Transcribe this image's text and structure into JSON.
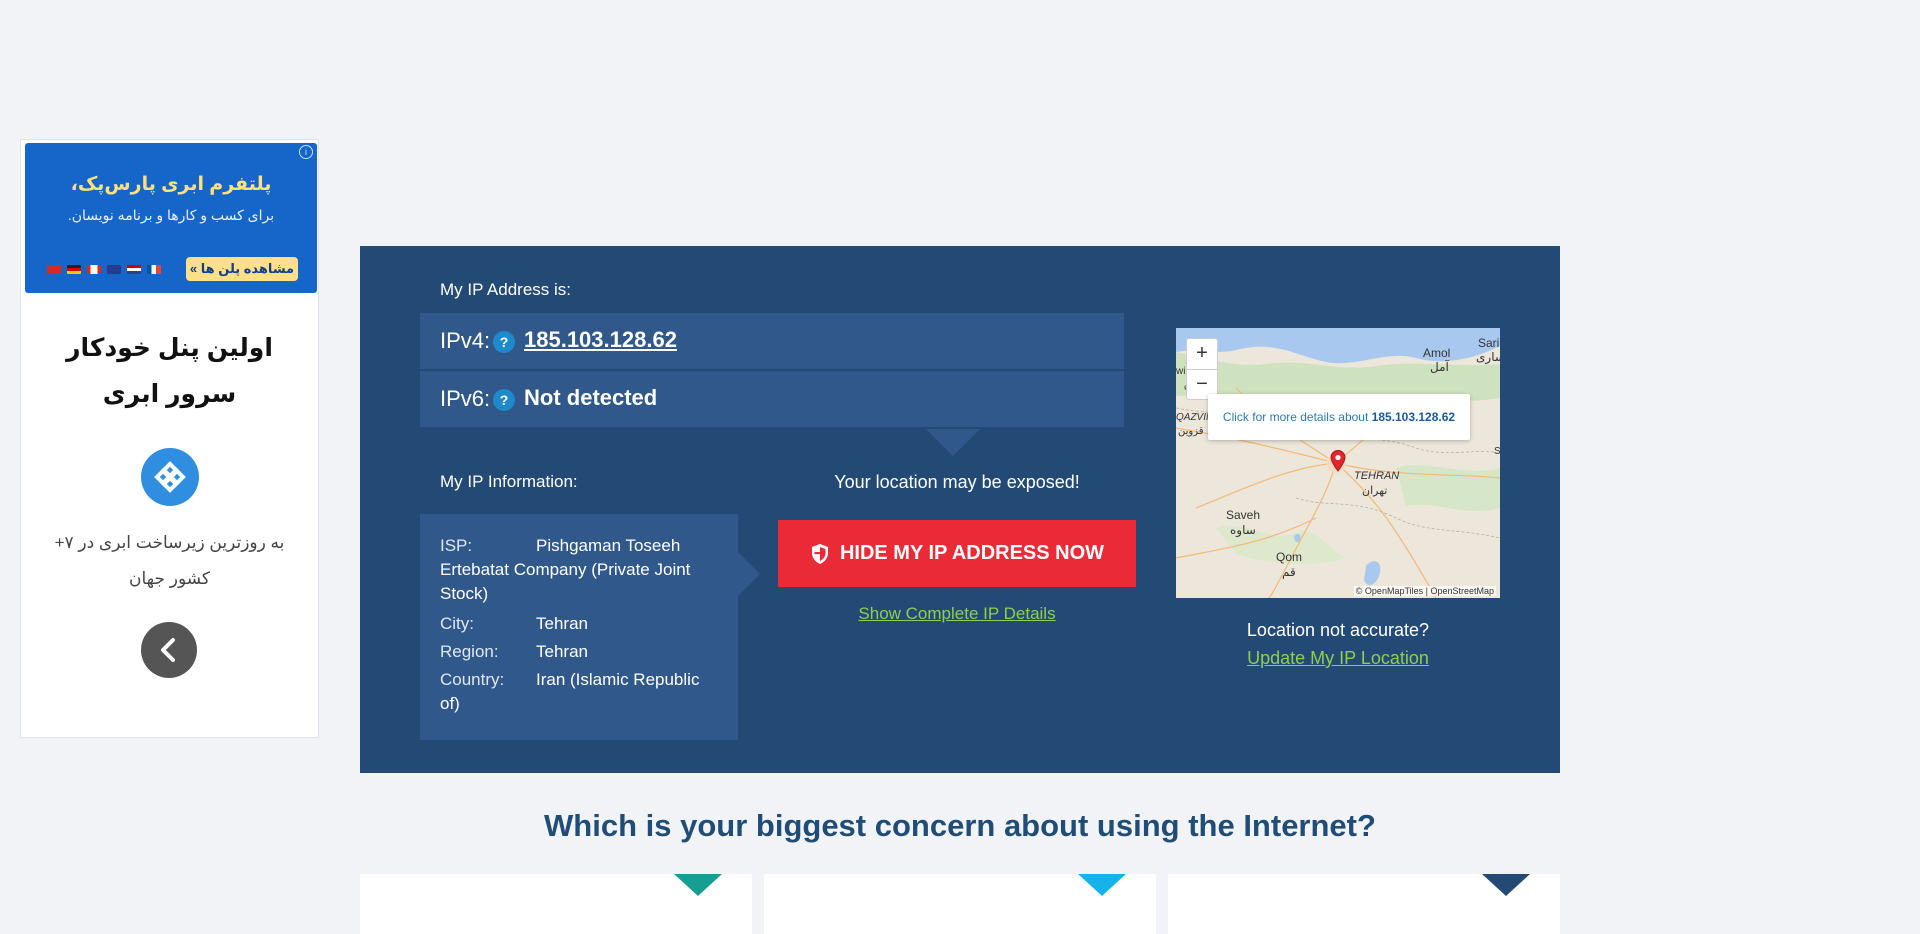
{
  "ad": {
    "banner_title": "پلتفرم ابری پارس‌پک،",
    "banner_sub": "برای کسب و کارها و برنامه نویسان.",
    "banner_button": "مشاهده پلن ها »",
    "headline": "اولین پنل خودکار سرور ابری",
    "body": "به روزترین زیرساخت ابری در ۷+ کشور جهان"
  },
  "ip": {
    "heading": "My IP Address is:",
    "ipv4_label": "IPv4:",
    "ipv4_value": "185.103.128.62",
    "ipv6_label": "IPv6:",
    "ipv6_value": "Not detected",
    "help_glyph": "?"
  },
  "info": {
    "heading": "My IP Information:",
    "isp_label": "ISP:",
    "isp_value": "Pishgaman Toseeh",
    "isp_value_cont": "Ertebatat Company (Private Joint Stock)",
    "city_label": "City:",
    "city_value": "Tehran",
    "region_label": "Region:",
    "region_value": "Tehran",
    "country_label": "Country:",
    "country_value": "Iran (Islamic Republic",
    "country_value_cont": "of)"
  },
  "action": {
    "warning": "Your location may be exposed!",
    "hide_button": "HIDE MY IP ADDRESS NOW",
    "details_link": "Show Complete IP Details"
  },
  "map": {
    "zoom_in": "+",
    "zoom_out": "−",
    "popup_text": "Click for more details about",
    "popup_ip": "185.103.128.62",
    "attribution": "© OpenMapTiles | OpenStreetMap",
    "labels": [
      "Amol",
      "آمل",
      "Sari",
      "ساری",
      "QAZVIN",
      "قزوین",
      "TEHRAN",
      "تهران",
      "Saveh",
      "ساوه",
      "Qom",
      "قم",
      "win",
      "ق",
      "S"
    ]
  },
  "location": {
    "question": "Location not accurate?",
    "update_link": "Update My IP Location"
  },
  "bottom": {
    "concern": "Which is your biggest concern about using the Internet?"
  },
  "colors": {
    "card_1": "#169e92",
    "card_2": "#16b3ea",
    "card_3": "#234a74"
  }
}
